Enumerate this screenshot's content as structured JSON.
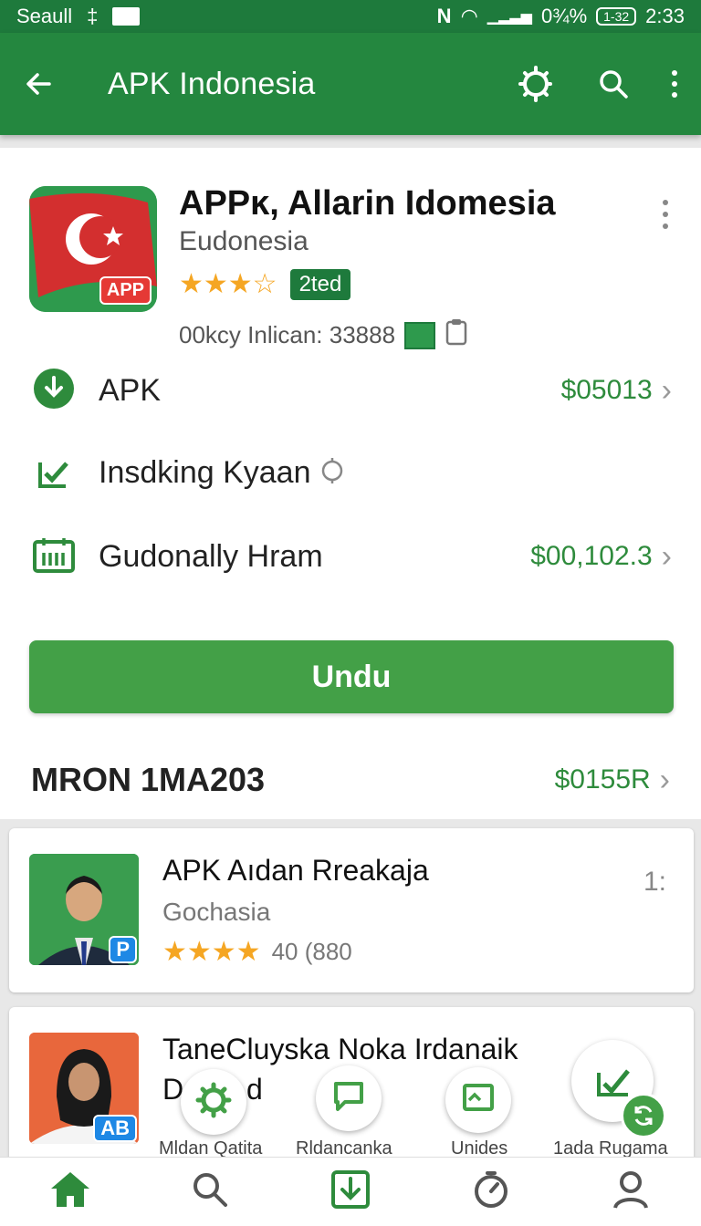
{
  "status": {
    "carrier": "Seaull",
    "battery_text": "0¾%",
    "battery_box": "1-32",
    "time": "2:33"
  },
  "appbar": {
    "title": "APK Indonesia",
    "icons": [
      "back-arrow-icon",
      "gear-icon",
      "search-icon",
      "more-vert-icon"
    ]
  },
  "app": {
    "title": "APPĸ, Allarin Idomesia",
    "developer": "Eudonesia",
    "stars": "★★★☆",
    "rated_label": "2ted",
    "downloads": "00kcy Inlican: 33888",
    "icon_badge": "APP"
  },
  "rows": [
    {
      "label": "APK",
      "value": "$05013",
      "icon": "download-circle-icon"
    },
    {
      "label": "Insdking Kyaan",
      "value": "",
      "icon": "check-install-icon"
    },
    {
      "label": "Gudonally Hram",
      "value": "$00,102.3",
      "icon": "calendar-icon"
    }
  ],
  "primary_button": "Undu",
  "section": {
    "title": "MRON 1MA203",
    "value": "$0155R"
  },
  "list": [
    {
      "name": "APK Aıdan Rreakaja",
      "sub": "Gochasia",
      "rating": "40 (880",
      "stars": "★★★★",
      "badge": "P",
      "more": "1:"
    },
    {
      "name": "TaneCluyska Noka Irdanaik",
      "sub": "D",
      "sub2": "d",
      "badge": "AB"
    }
  ],
  "shortcuts": [
    "Mldan Qatita",
    "Rldancanka",
    "Unides",
    "1ada Rugama"
  ],
  "bottom_nav": [
    "home-icon",
    "search-icon",
    "download-box-icon",
    "timer-icon",
    "person-icon"
  ],
  "colors": {
    "primary": "#24873f",
    "accent": "#43a047",
    "price": "#2e8b3c",
    "star": "#f5a623"
  }
}
